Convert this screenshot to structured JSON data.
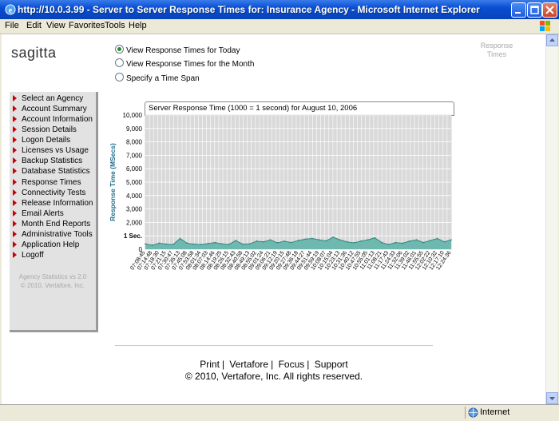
{
  "window": {
    "title": "http://10.0.3.99 - Server to Server Response Times for: Insurance Agency - Microsoft Internet Explorer"
  },
  "menu": [
    "File",
    "Edit",
    "View",
    "Favorites",
    "Tools",
    "Help"
  ],
  "page": {
    "logo": "sagitta",
    "response_times_link": "Response Times",
    "radios": [
      {
        "label": "View Response Times for Today",
        "checked": true
      },
      {
        "label": "View Response Times for the Month",
        "checked": false
      },
      {
        "label": "Specify a Time Span",
        "checked": false
      }
    ],
    "nav": [
      "Select an Agency",
      "Account Summary",
      "Account Information",
      "Session Details",
      "Logon Details",
      "Licenses vs Usage",
      "Backup Statistics",
      "Database Statistics",
      "Response Times",
      "Connectivity Tests",
      "Release Information",
      "Email Alerts",
      "Month End Reports",
      "Administrative Tools",
      "Application Help",
      "Logoff"
    ],
    "sidebar_footer": {
      "line1": "Agency Statistics vs 2.0",
      "line2": "© 2010, Vertafore, Inc."
    },
    "footer_links": [
      "Print",
      "Vertafore",
      "Focus",
      "Support"
    ],
    "copyright": "© 2010, Vertafore, Inc. All rights reserved."
  },
  "status": {
    "zone": "Internet"
  },
  "colors": {
    "area_fill": "#6fb8b0",
    "area_line": "#2e8a80",
    "plot_bg": "#d9d9d9",
    "grid": "#ffffff",
    "axis_title": "#1f6f8b",
    "nav_arrow": "#cc0000"
  },
  "chart_data": {
    "type": "area",
    "title": "Server Response Time (1000 = 1 second) for August 10, 2006",
    "ylabel": "Response Time (MSecs)",
    "xlabel": "",
    "ylim": [
      0,
      10000
    ],
    "yticks": [
      {
        "v": 10000,
        "label": "10,000"
      },
      {
        "v": 9000,
        "label": "9,000"
      },
      {
        "v": 8000,
        "label": "8,000"
      },
      {
        "v": 7000,
        "label": "7,000"
      },
      {
        "v": 6000,
        "label": "6,000"
      },
      {
        "v": 5000,
        "label": "5,000"
      },
      {
        "v": 4000,
        "label": "4,000"
      },
      {
        "v": 3000,
        "label": "3,000"
      },
      {
        "v": 2000,
        "label": "2,000"
      },
      {
        "v": 1000,
        "label": "1 Sec."
      },
      {
        "v": 0,
        "label": "0"
      }
    ],
    "x": [
      "07:08:45",
      "07:14:48",
      "07:18:30",
      "07:21:15",
      "07:30:47",
      "07:35:13",
      "07:45:08",
      "07:53:58",
      "08:01:34",
      "08:07:03",
      "08:14:46",
      "08:19:25",
      "08:26:15",
      "08:32:43",
      "08:40:58",
      "08:49:13",
      "08:55:02",
      "09:01:24",
      "09:06:21",
      "09:12:19",
      "09:20:15",
      "09:27:48",
      "09:36:18",
      "09:44:27",
      "09:51:44",
      "09:59:19",
      "10:08:07",
      "10:15:04",
      "10:23:13",
      "10:31:36",
      "10:40:12",
      "10:47:55",
      "10:55:05",
      "11:01:13",
      "11:08:21",
      "11:17:43",
      "11:24:33",
      "11:32:06",
      "11:39:02",
      "11:46:01",
      "11:55:55",
      "12:02:22",
      "12:10:32",
      "12:17:10",
      "12:24:36"
    ],
    "values": [
      400,
      300,
      450,
      380,
      350,
      800,
      450,
      380,
      350,
      420,
      500,
      400,
      350,
      650,
      380,
      400,
      600,
      550,
      700,
      480,
      600,
      500,
      650,
      750,
      800,
      700,
      620,
      900,
      700,
      550,
      480,
      600,
      700,
      850,
      500,
      350,
      500,
      450,
      600,
      700,
      500,
      650,
      800,
      550,
      700
    ]
  }
}
